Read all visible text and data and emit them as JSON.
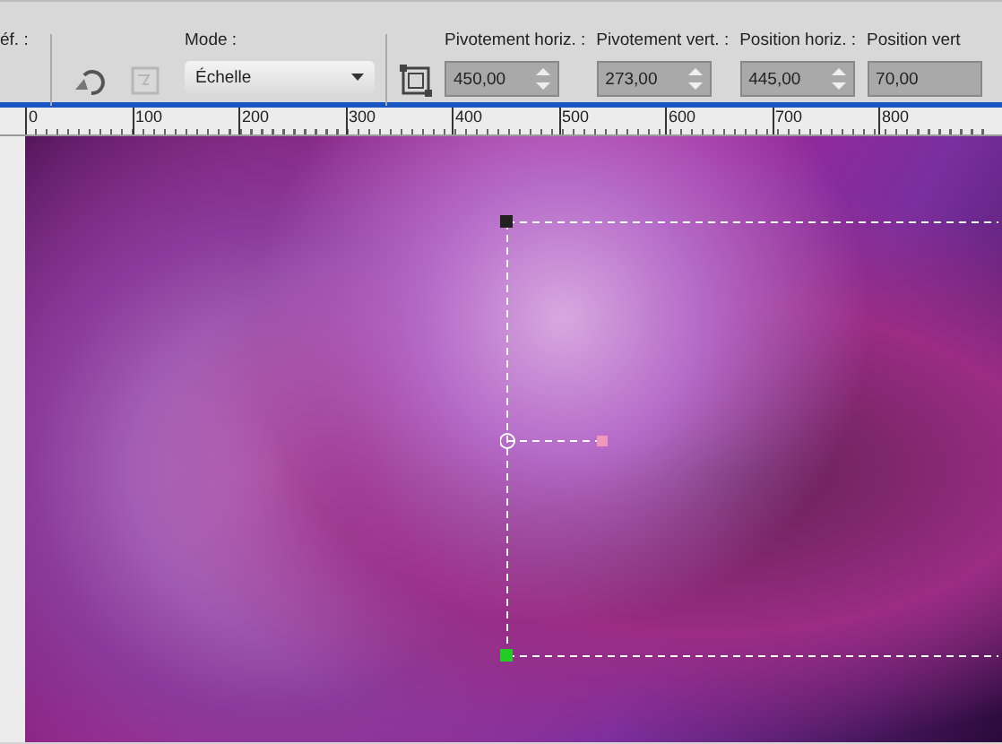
{
  "toolbar": {
    "cut_label": "éf. :",
    "mode": {
      "label": "Mode :",
      "value": "Échelle"
    },
    "fields": [
      {
        "label": "Pivotement horiz. :",
        "value": "450,00"
      },
      {
        "label": "Pivotement vert. :",
        "value": "273,00"
      },
      {
        "label": "Position horiz. :",
        "value": "445,00"
      },
      {
        "label": "Position vert",
        "value": "70,00"
      }
    ]
  },
  "ruler": {
    "ticks": [
      "0",
      "100",
      "200",
      "300",
      "400",
      "500",
      "600",
      "700",
      "800"
    ]
  }
}
